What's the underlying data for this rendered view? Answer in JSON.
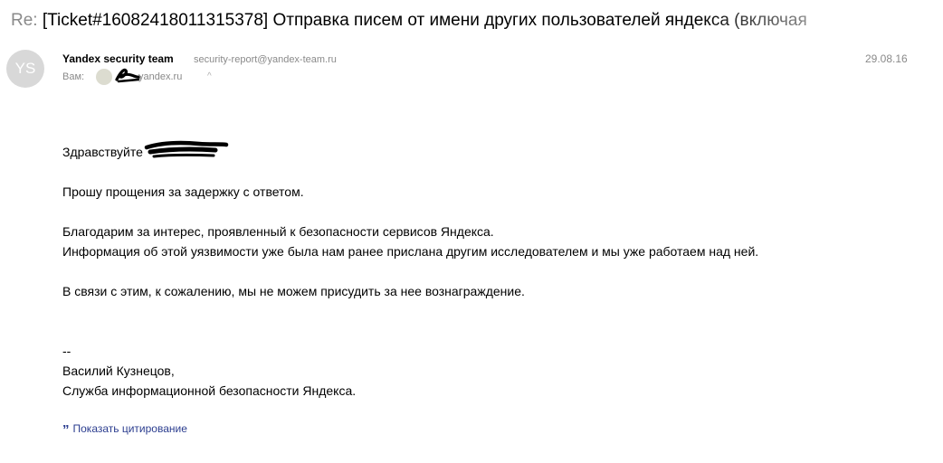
{
  "subject": {
    "prefix": "Re:",
    "ticket": "[Ticket#16082418011315378]",
    "title": "Отправка писем от имени других пользователей яндекса (включая"
  },
  "sender": {
    "avatar_initials": "YS",
    "name": "Yandex security team",
    "email": "security-report@yandex-team.ru",
    "date": "29.08.16"
  },
  "recipient": {
    "label": "Вам:",
    "domain": "yandex.ru",
    "chevron": "^"
  },
  "body": {
    "greeting": "Здравствуйте",
    "line1": "Прошу прощения за задержку с ответом.",
    "line2": "Благодарим за интерес, проявленный к безопасности сервисов Яндекса.",
    "line3": "Информация об этой уязвимости уже была нам ранее прислана другим исследователем и мы уже работаем над ней.",
    "line4": "В связи с этим, к сожалению, мы не можем присудить за нее вознаграждение.",
    "sig_dash": "--",
    "sig_name": "Василий Кузнецов,",
    "sig_org": "Служба информационной безопасности Яндекса."
  },
  "actions": {
    "show_quote": "Показать цитирование",
    "quote_icon": "quote-icon"
  },
  "colors": {
    "muted": "#8a8a8a",
    "link": "#2b3d8f"
  }
}
